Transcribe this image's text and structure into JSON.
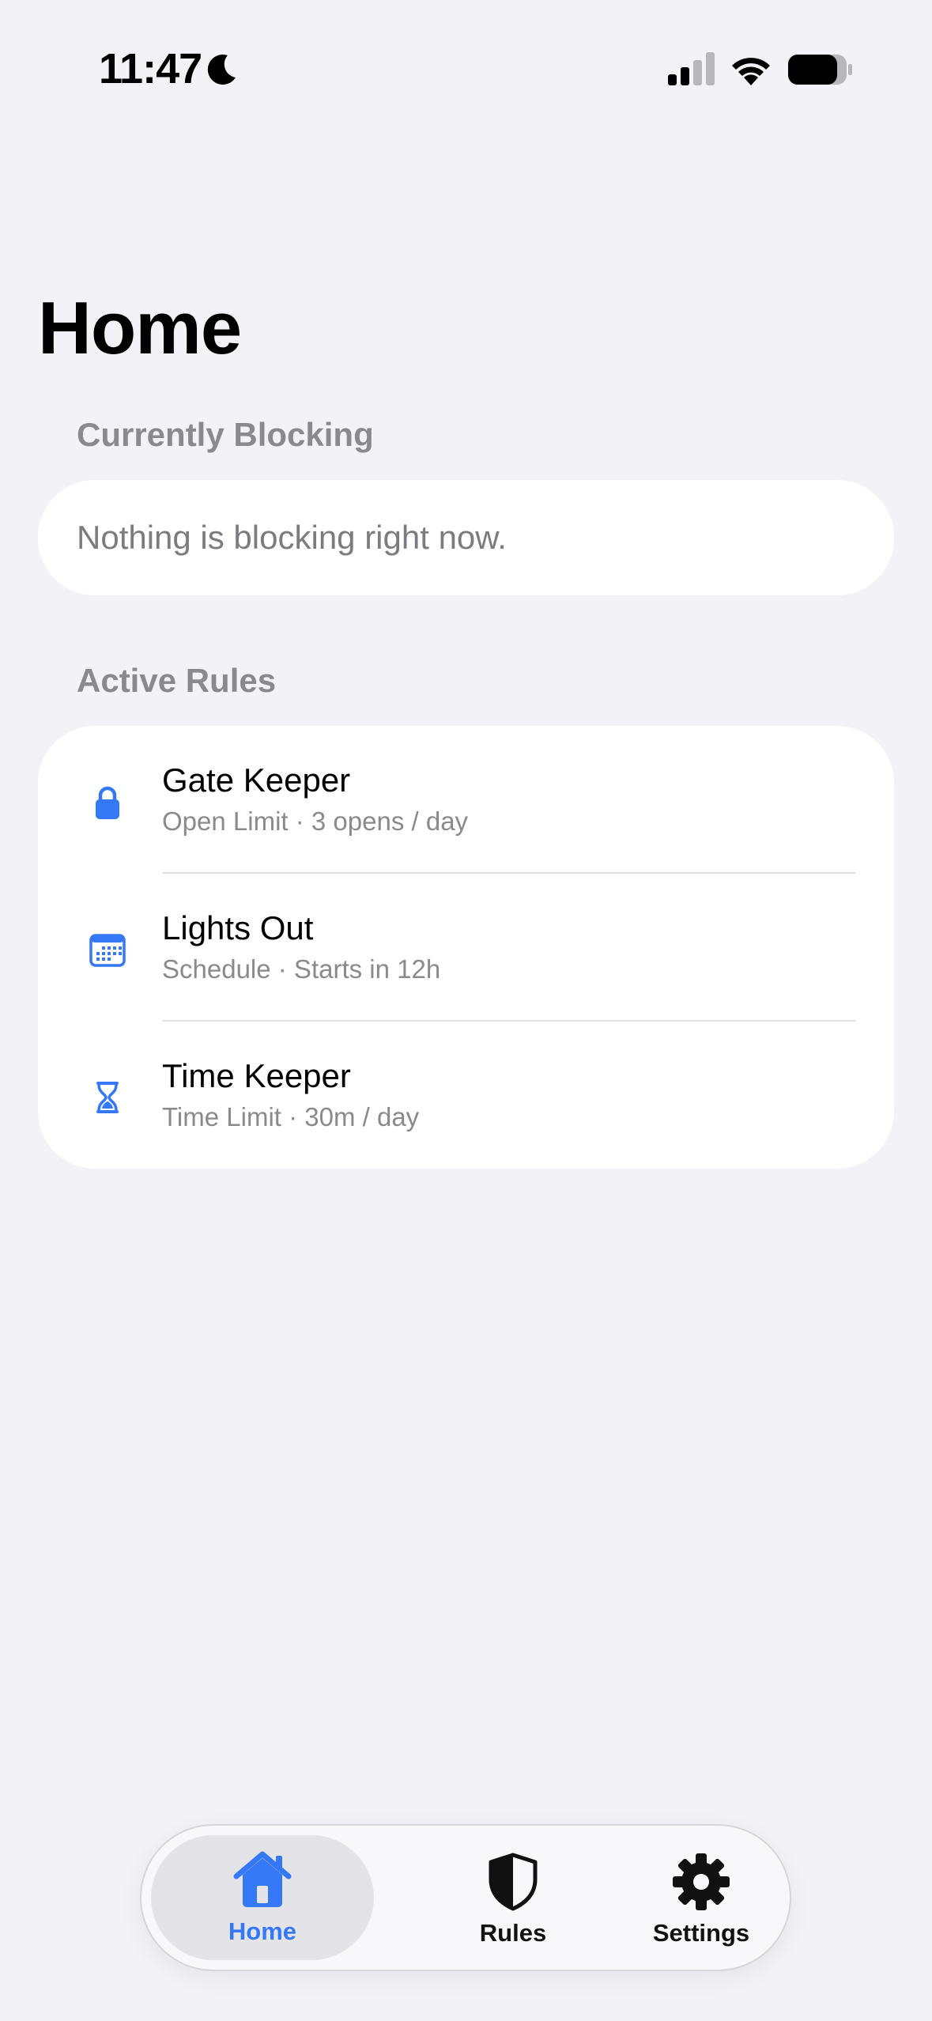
{
  "status_bar": {
    "time": "11:47",
    "icons": [
      "moon-icon",
      "cellular-signal-icon",
      "wifi-icon",
      "battery-icon"
    ]
  },
  "page": {
    "title": "Home"
  },
  "currently_blocking": {
    "header": "Currently Blocking",
    "empty_text": "Nothing is blocking right now."
  },
  "active_rules": {
    "header": "Active Rules",
    "items": [
      {
        "title": "Gate Keeper",
        "subtitle": "Open Limit · 3 opens / day",
        "icon": "lock-icon"
      },
      {
        "title": "Lights Out",
        "subtitle": "Schedule · Starts in 12h",
        "icon": "calendar-icon"
      },
      {
        "title": "Time Keeper",
        "subtitle": "Time Limit · 30m / day",
        "icon": "hourglass-icon"
      }
    ]
  },
  "tab_bar": {
    "selected": "Home",
    "items": [
      {
        "label": "Home",
        "icon": "house-icon"
      },
      {
        "label": "Rules",
        "icon": "shield-icon"
      },
      {
        "label": "Settings",
        "icon": "gear-icon"
      }
    ]
  },
  "colors": {
    "background": "#F2F2F7",
    "card": "#FFFFFF",
    "accent": "#3478F6",
    "secondary_text": "#8A8A8E"
  }
}
